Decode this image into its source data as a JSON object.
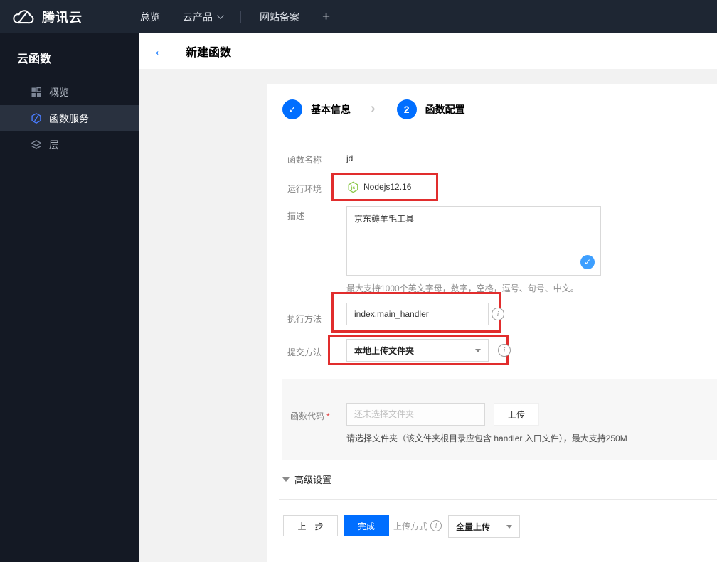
{
  "topnav": {
    "brand": "腾讯云",
    "items": [
      {
        "label": "总览"
      },
      {
        "label": "云产品"
      },
      {
        "label": "网站备案"
      },
      {
        "label": "+"
      }
    ]
  },
  "sidebar": {
    "title": "云函数",
    "items": [
      {
        "label": "概览"
      },
      {
        "label": "函数服务"
      },
      {
        "label": "层"
      }
    ]
  },
  "header": {
    "title": "新建函数"
  },
  "steps": {
    "step1": {
      "num": "✓",
      "label": "基本信息"
    },
    "chevron": "›",
    "step2": {
      "num": "2",
      "label": "函数配置"
    }
  },
  "form": {
    "name_label": "函数名称",
    "name_value": "jd",
    "runtime_label": "运行环境",
    "runtime_value": "Nodejs12.16",
    "desc_label": "描述",
    "desc_value": "京东薅羊毛工具",
    "desc_hint": "最大支持1000个英文字母，数字，空格，逗号、句号、中文。",
    "handler_label": "执行方法",
    "handler_value": "index.main_handler",
    "submit_label": "提交方法",
    "submit_value": "本地上传文件夹",
    "code_label": "函数代码",
    "code_required": "*",
    "code_placeholder": "还未选择文件夹",
    "upload_button": "上传",
    "code_hint": "请选择文件夹（该文件夹根目录应包含 handler 入口文件），最大支持250M",
    "advanced_label": "高级设置"
  },
  "footer": {
    "prev_button": "上一步",
    "finish_button": "完成",
    "upload_mode_label": "上传方式",
    "upload_mode_value": "全量上传"
  },
  "icons": {
    "back_arrow": "←",
    "info": "i",
    "check": "✓",
    "node_js": "js"
  },
  "colors": {
    "accent_blue": "#006eff",
    "annotation_red": "#e12d2d",
    "node_green": "#8cc84b",
    "valid_check_blue": "#3d9fff",
    "topnav_bg": "#1e2633",
    "sidebar_bg": "#141924",
    "sidebar_active_bg": "#29313f",
    "page_bg": "#f2f2f2"
  }
}
